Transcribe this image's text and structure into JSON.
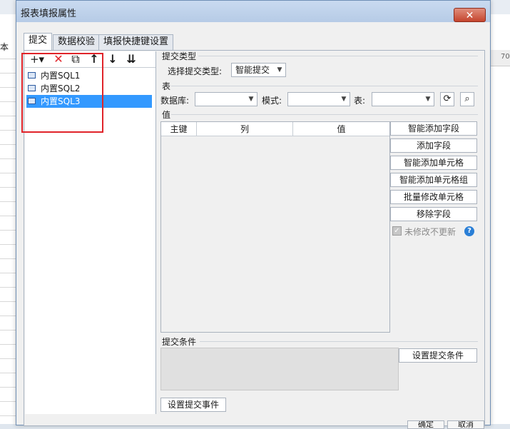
{
  "dialog": {
    "title": "报表填报属性",
    "close_label": "✕",
    "tabs": [
      {
        "label": "提交"
      },
      {
        "label": "数据校验"
      },
      {
        "label": "填报快捷键设置"
      }
    ]
  },
  "toolbar": {
    "add_label": "+▾",
    "delete_label": "✕",
    "copy_label": "⧉",
    "up_label": "↑",
    "down_label": "↓",
    "bottom_label": "⇊"
  },
  "sql_list": {
    "items": [
      {
        "label": "内置SQL1"
      },
      {
        "label": "内置SQL2"
      },
      {
        "label": "内置SQL3",
        "selected": true
      }
    ]
  },
  "submit_type": {
    "section_label": "提交类型",
    "select_label": "选择提交类型:",
    "selected_value": "智能提交"
  },
  "table_section": {
    "section_label": "表",
    "database_label": "数据库:",
    "database_value": "",
    "schema_label": "模式:",
    "schema_value": "",
    "table_label": "表:",
    "table_value": "",
    "refresh_icon": "refresh-icon",
    "search_icon": "search-icon"
  },
  "value_section": {
    "section_label": "值",
    "columns": [
      "主键",
      "列",
      "值"
    ]
  },
  "value_actions": {
    "smart_add_field": "智能添加字段",
    "add_field": "添加字段",
    "smart_add_cell": "智能添加单元格",
    "smart_add_cell_group": "智能添加单元格组",
    "batch_modify_cell": "批量修改单元格",
    "remove_field": "移除字段",
    "no_update_label": "未修改不更新",
    "no_update_checked": true,
    "help_label": "?"
  },
  "condition_section": {
    "section_label": "提交条件",
    "set_condition_label": "设置提交条件"
  },
  "event": {
    "set_event_label": "设置提交事件"
  },
  "footer": {
    "ok_label": "确定",
    "cancel_label": "取消"
  },
  "background": {
    "ruler_text": "70",
    "side_label": "本"
  },
  "colors": {
    "selection": "#3399ff",
    "highlight_box": "#e0242a",
    "help_icon": "#2a7fd6"
  }
}
